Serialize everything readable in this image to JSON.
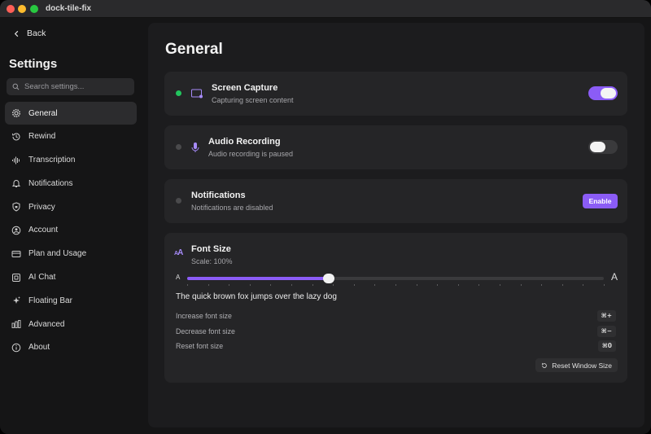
{
  "window": {
    "title": "dock-tile-fix"
  },
  "sidebar": {
    "back_label": "Back",
    "title": "Settings",
    "search_placeholder": "Search settings...",
    "items": [
      {
        "label": "General",
        "icon": "gear-icon",
        "active": true
      },
      {
        "label": "Rewind",
        "icon": "history-icon"
      },
      {
        "label": "Transcription",
        "icon": "waveform-icon"
      },
      {
        "label": "Notifications",
        "icon": "bell-icon"
      },
      {
        "label": "Privacy",
        "icon": "shield-icon"
      },
      {
        "label": "Account",
        "icon": "user-circle-icon"
      },
      {
        "label": "Plan and Usage",
        "icon": "credit-card-icon"
      },
      {
        "label": "AI Chat",
        "icon": "chat-icon"
      },
      {
        "label": "Floating Bar",
        "icon": "sparkle-icon"
      },
      {
        "label": "Advanced",
        "icon": "bars-icon"
      },
      {
        "label": "About",
        "icon": "info-icon"
      }
    ]
  },
  "main": {
    "title": "General",
    "screen_capture": {
      "title": "Screen Capture",
      "subtitle": "Capturing screen content",
      "enabled": true,
      "status_color": "#22c55e"
    },
    "audio_recording": {
      "title": "Audio Recording",
      "subtitle": "Audio recording is paused",
      "enabled": false
    },
    "notifications": {
      "title": "Notifications",
      "subtitle": "Notifications are disabled",
      "button_label": "Enable"
    },
    "font_size": {
      "title": "Font Size",
      "scale_label": "Scale: 100%",
      "slider_small_label": "A",
      "slider_large_label": "A",
      "slider_value_fraction": 0.34,
      "preview_text": "The quick brown fox jumps over the lazy dog",
      "shortcuts": [
        {
          "label": "Increase font size",
          "key": "⌘+"
        },
        {
          "label": "Decrease font size",
          "key": "⌘−"
        },
        {
          "label": "Reset font size",
          "key": "⌘0"
        }
      ],
      "reset_window_label": "Reset Window Size"
    }
  },
  "colors": {
    "accent": "#8b5cf6",
    "active_dot": "#22c55e",
    "background": "#151516",
    "card": "#252527"
  }
}
